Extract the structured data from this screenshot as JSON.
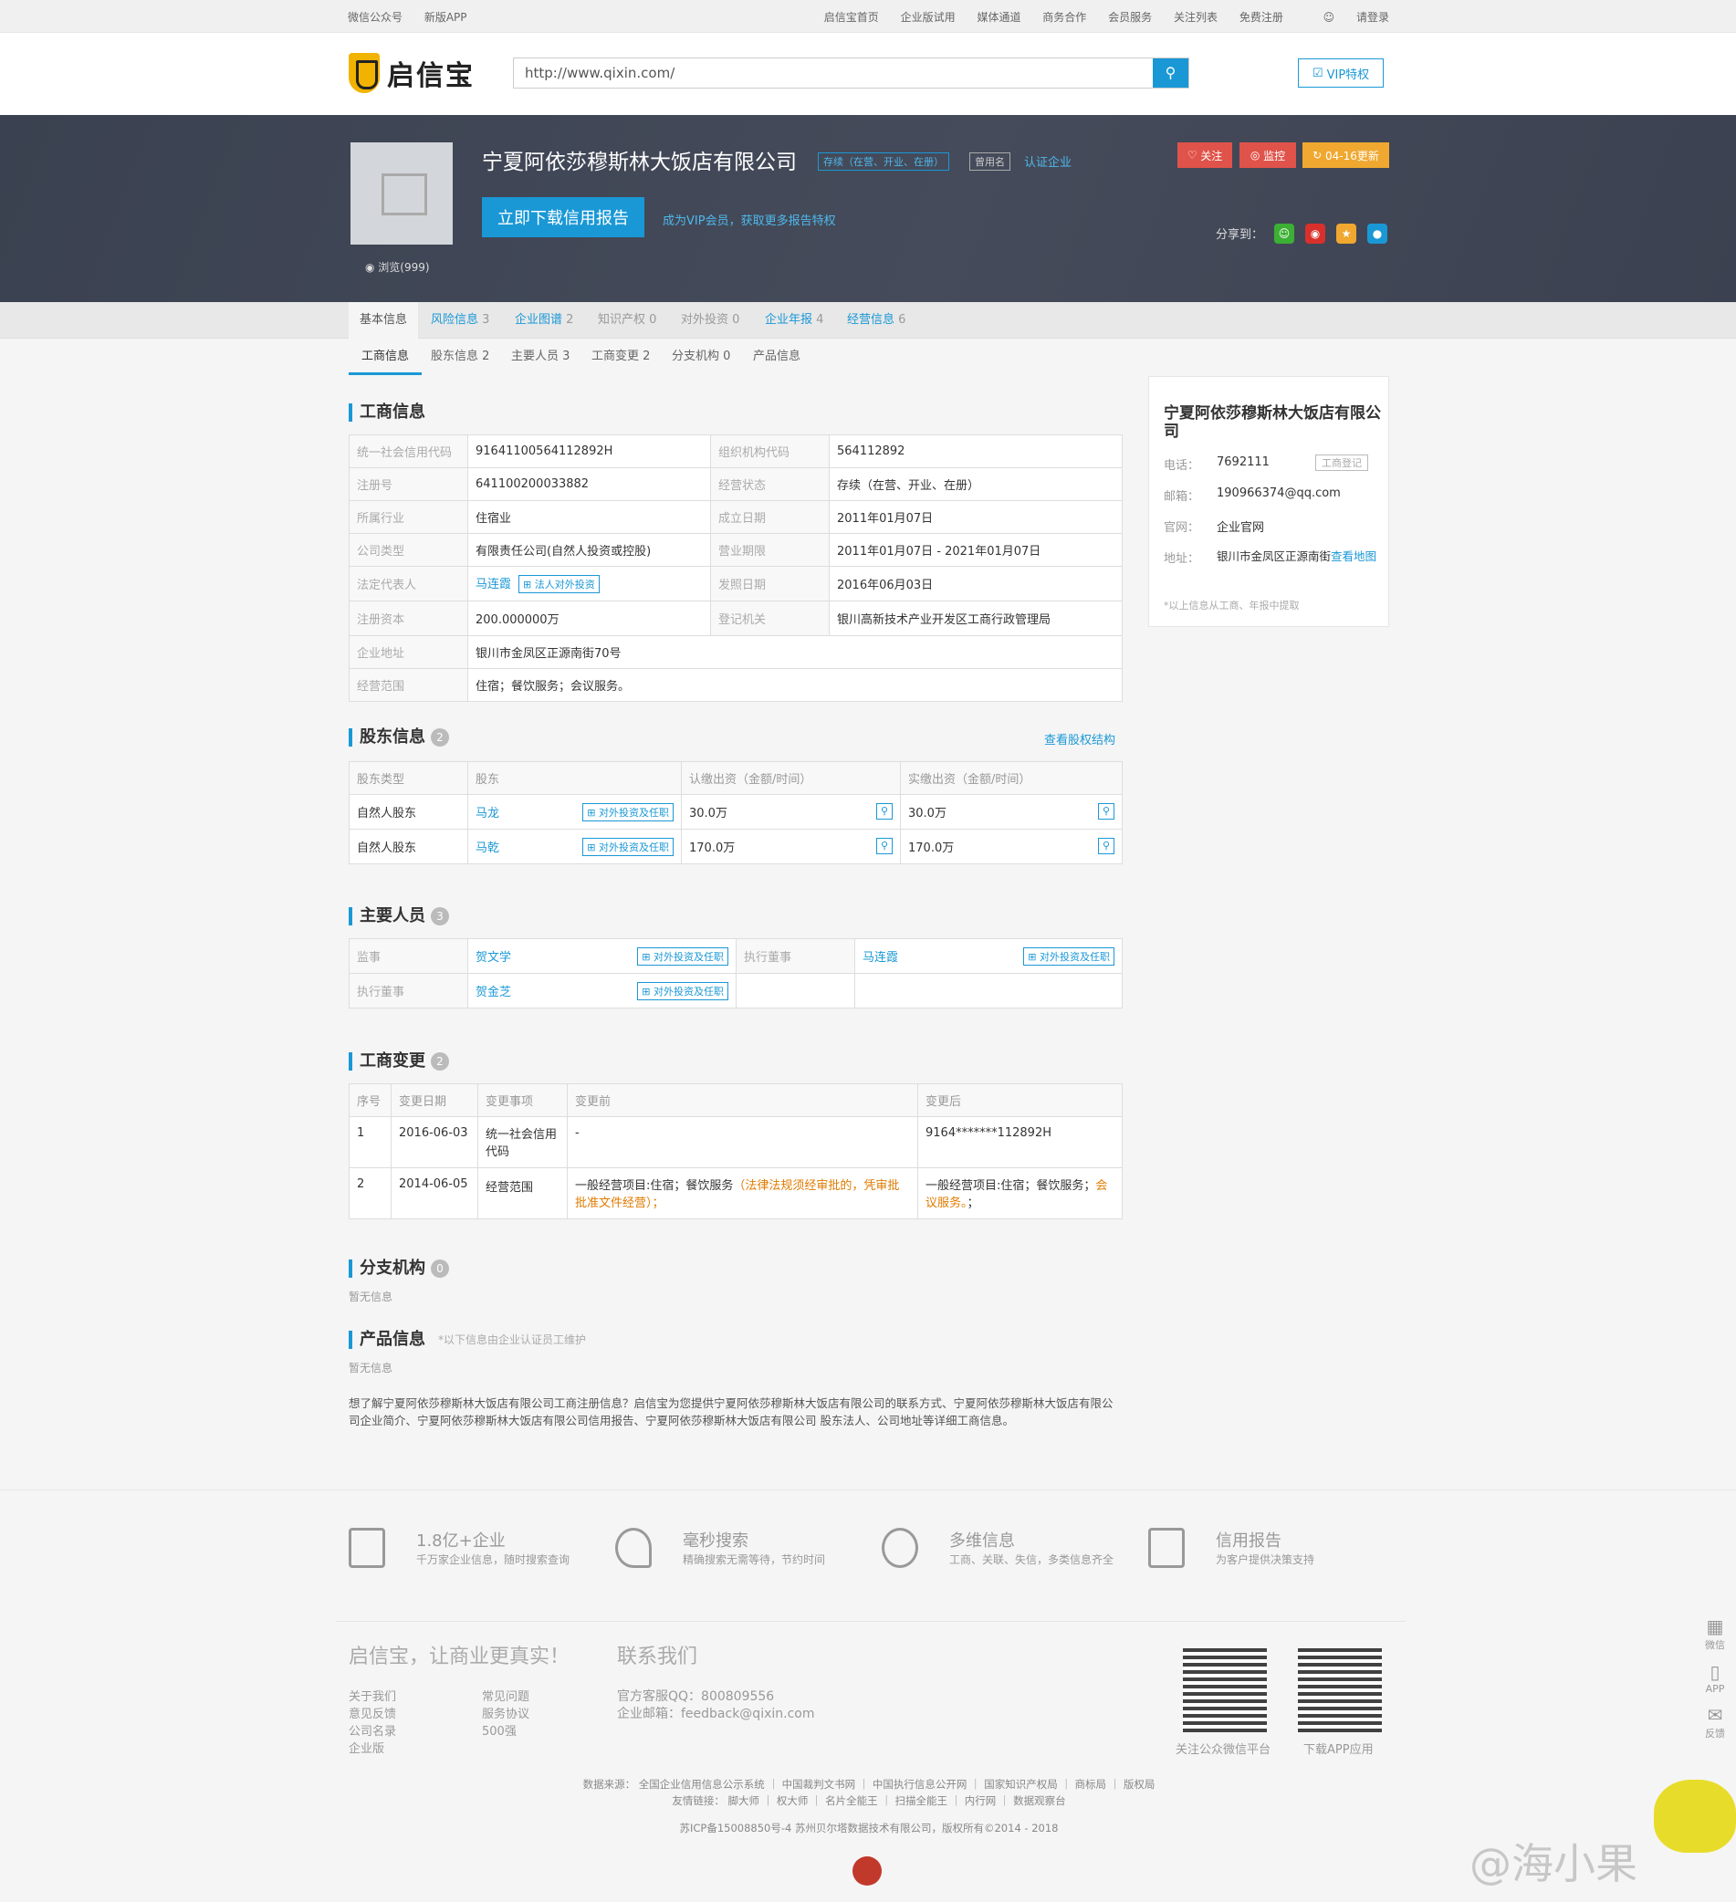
{
  "topbar": {
    "left": [
      "微信公众号",
      "新版APP"
    ],
    "right": [
      "启信宝首页",
      "企业版试用",
      "媒体通道",
      "商务合作",
      "会员服务",
      "关注列表",
      "免费注册",
      "请登录"
    ]
  },
  "header": {
    "logo": "启信宝",
    "search_value": "http://www.qixin.com/",
    "vip": "VIP特权"
  },
  "banner": {
    "company": "宁夏阿依莎穆斯林大饭店有限公司",
    "status_tag": "存续（在营、开业、在册）",
    "alias_tag": "曾用名",
    "cert": "认证企业",
    "download": "立即下载信用报告",
    "vip_note": "成为VIP会员，获取更多报告特权",
    "views": "浏览(999)",
    "follow": "关注",
    "monitor": "监控",
    "update": "04-16更新",
    "share": "分享到："
  },
  "tabs1": [
    {
      "label": "基本信息",
      "count": ""
    },
    {
      "label": "风险信息",
      "count": "3"
    },
    {
      "label": "企业图谱",
      "count": "2"
    },
    {
      "label": "知识产权",
      "count": "0"
    },
    {
      "label": "对外投资",
      "count": "0"
    },
    {
      "label": "企业年报",
      "count": "4"
    },
    {
      "label": "经营信息",
      "count": "6"
    }
  ],
  "tabs2": [
    "工商信息",
    "股东信息 2",
    "主要人员 3",
    "工商变更 2",
    "分支机构 0",
    "产品信息"
  ],
  "biz": {
    "title": "工商信息",
    "rows": [
      [
        "统一社会信用代码",
        "91641100564112892H",
        "组织机构代码",
        "564112892"
      ],
      [
        "注册号",
        "641100200033882",
        "经营状态",
        "存续（在营、开业、在册）"
      ],
      [
        "所属行业",
        "住宿业",
        "成立日期",
        "2011年01月07日"
      ],
      [
        "公司类型",
        "有限责任公司(自然人投资或控股)",
        "营业期限",
        "2011年01月07日 - 2021年01月07日"
      ],
      [
        "法定代表人",
        "马连霞",
        "发照日期",
        "2016年06月03日"
      ],
      [
        "注册资本",
        "200.000000万",
        "登记机关",
        "银川高新技术产业开发区工商行政管理局"
      ]
    ],
    "legal_tag": "法人对外投资",
    "addr_label": "企业地址",
    "addr": "银川市金凤区正源南街70号",
    "scope_label": "经营范围",
    "scope": "住宿；餐饮服务；会议服务。"
  },
  "holders": {
    "title": "股东信息",
    "count": "2",
    "link": "查看股权结构",
    "headers": [
      "股东类型",
      "股东",
      "认缴出资（金额/时间）",
      "实缴出资（金额/时间）"
    ],
    "tag": "对外投资及任职",
    "rows": [
      [
        "自然人股东",
        "马龙",
        "30.0万",
        "30.0万"
      ],
      [
        "自然人股东",
        "马乾",
        "170.0万",
        "170.0万"
      ]
    ]
  },
  "staff": {
    "title": "主要人员",
    "count": "3",
    "tag": "对外投资及任职",
    "rows": [
      [
        "监事",
        "贺文学",
        "执行董事",
        "马连霞"
      ],
      [
        "执行董事",
        "贺金芝",
        "",
        ""
      ]
    ]
  },
  "changes": {
    "title": "工商变更",
    "count": "2",
    "headers": [
      "序号",
      "变更日期",
      "变更事项",
      "变更前",
      "变更后"
    ],
    "rows": [
      {
        "no": "1",
        "date": "2016-06-03",
        "item": "统一社会信用代码",
        "before": "-",
        "before_o": "",
        "after": "9164*******112892H",
        "after_o": "",
        "after_end": ""
      },
      {
        "no": "2",
        "date": "2014-06-05",
        "item": "经营范围",
        "before": "一般经营项目:住宿；餐饮服务",
        "before_o": "（法律法规须经审批的，凭审批批准文件经营）；",
        "after": "一般经营项目:住宿；餐饮服务；",
        "after_o": "会议服务。",
        "after_end": "；"
      }
    ]
  },
  "branch": {
    "title": "分支机构",
    "count": "0",
    "empty": "暂无信息"
  },
  "product": {
    "title": "产品信息",
    "note": "*以下信息由企业认证员工维护",
    "empty": "暂无信息"
  },
  "desc": "想了解宁夏阿依莎穆斯林大饭店有限公司工商注册信息？启信宝为您提供宁夏阿依莎穆斯林大饭店有限公司的联系方式、宁夏阿依莎穆斯林大饭店有限公司企业简介、宁夏阿依莎穆斯林大饭店有限公司信用报告、宁夏阿依莎穆斯林大饭店有限公司 股东法人、公司地址等详细工商信息。",
  "side": {
    "title": "宁夏阿依莎穆斯林大饭店有限公司",
    "phone_l": "电话：",
    "phone": "7692111",
    "phone_tag": "工商登记",
    "email_l": "邮箱：",
    "email": "190966374@qq.com",
    "web_l": "官网：",
    "web": "企业官网",
    "addr_l": "地址：",
    "addr": "银川市金凤区正源南街",
    "addr_link": "查看地图",
    "note": "*以上信息从工商、年报中提取"
  },
  "features": [
    {
      "h": "1.8亿+企业",
      "d": "千万家企业信息，随时搜索查询"
    },
    {
      "h": "毫秒搜索",
      "d": "精确搜索无需等待，节约时间"
    },
    {
      "h": "多维信息",
      "d": "工商、关联、失信，多类信息齐全"
    },
    {
      "h": "信用报告",
      "d": "为客户提供决策支持"
    }
  ],
  "footer": {
    "slogan": "启信宝，让商业更真实！",
    "contact": "联系我们",
    "links1": [
      "关于我们",
      "意见反馈",
      "公司名录",
      "企业版"
    ],
    "links2": [
      "常见问题",
      "服务协议",
      "500强"
    ],
    "qq": "官方客服QQ：800809556",
    "mail": "企业邮箱：feedback@qixin.com",
    "qr1": "关注公众微信平台",
    "qr2": "下载APP应用",
    "sources": "数据来源： 全国企业信用信息公示系统 ｜ 中国裁判文书网 ｜ 中国执行信息公开网 ｜ 国家知识产权局 ｜ 商标局 ｜ 版权局",
    "friends": "友情链接： 脚大师 ｜ 权大师 ｜ 名片全能王 ｜ 扫描全能王 ｜ 内行网 ｜ 数据观察台",
    "icp": "苏ICP备15008850号-4 苏州贝尔塔数据技术有限公司，版权所有©2014 - 2018"
  },
  "rightbar": [
    "微信",
    "APP",
    "反馈"
  ],
  "watermark": "@海小果",
  "colors": {
    "accent": "#1a98d6",
    "banner": "#3f4554",
    "follow": "#e0534a",
    "update": "#f0a830"
  }
}
